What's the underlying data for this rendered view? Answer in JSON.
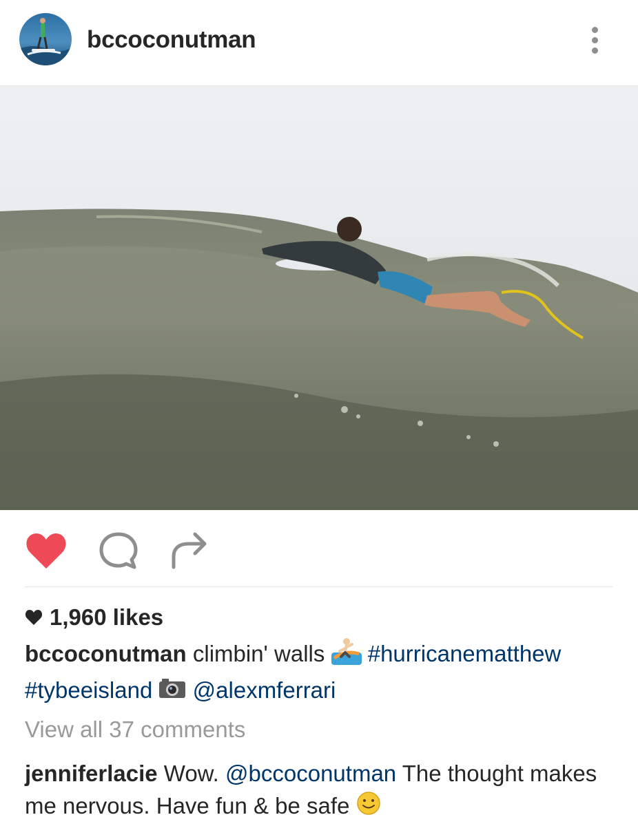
{
  "post": {
    "username": "bccoconutman",
    "image_alt": "Surfer paddling on a wave",
    "likes_text": "1,960 likes",
    "caption": {
      "username": "bccoconutman",
      "text": " climbin' walls ",
      "hashtag1": "#hurricanematthew",
      "hashtag2": "#tybeeisland",
      "mention": "@alexmferrari"
    },
    "view_all_comments": "View all 37 comments",
    "comment": {
      "username": "jenniferlacie",
      "text_before": " Wow. ",
      "mention": "@bccoconutman",
      "text_after": " The thought makes me nervous. Have fun & be safe "
    }
  },
  "icons": {
    "avatar": "avatar",
    "more": "more-vertical-icon",
    "like": "heart-icon",
    "comment": "comment-bubble-icon",
    "share": "share-arrow-icon",
    "likes_heart": "small-heart-icon",
    "surfer_emoji": "surfer-emoji",
    "camera_emoji": "camera-emoji",
    "smile_emoji": "smile-emoji"
  },
  "colors": {
    "like_red": "#ed4956",
    "link_blue": "#003569",
    "muted_gray": "#999999",
    "text_dark": "#262626"
  }
}
